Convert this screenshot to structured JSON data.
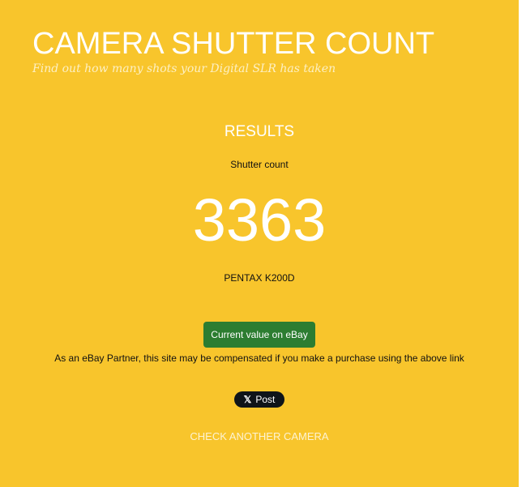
{
  "header": {
    "title": "CAMERA SHUTTER COUNT",
    "tagline": "Find out how many shots your Digital SLR has taken"
  },
  "results": {
    "heading": "RESULTS",
    "shutter_label": "Shutter count",
    "shutter_count": "3363",
    "camera_model": "PENTAX K200D"
  },
  "ebay": {
    "button_label": "Current value on eBay",
    "disclaimer": "As an eBay Partner, this site may be compensated if you make a purchase using the above link"
  },
  "share": {
    "post_label": "Post",
    "post_icon": "x-logo-icon",
    "post_icon_glyph": "𝕏"
  },
  "footer": {
    "check_another_label": "CHECK ANOTHER CAMERA"
  },
  "colors": {
    "background": "#f8c52c",
    "ebay_button": "#2c7d31",
    "post_button": "#0f1419",
    "text_light": "#ffffff"
  }
}
